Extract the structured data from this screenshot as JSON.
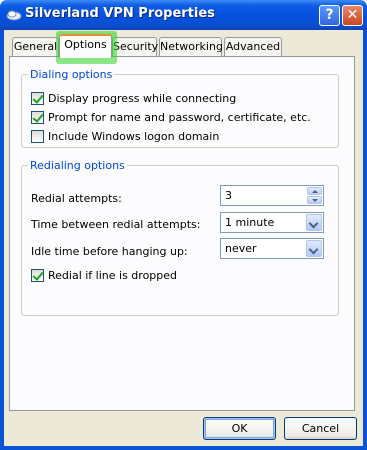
{
  "window": {
    "title": "Silverland VPN Properties",
    "icon": "network-connection-icon",
    "help_button": "?",
    "close_button": "✕"
  },
  "tabs": [
    {
      "label": "General",
      "active": false
    },
    {
      "label": "Options",
      "active": true
    },
    {
      "label": "Security",
      "active": false
    },
    {
      "label": "Networking",
      "active": false
    },
    {
      "label": "Advanced",
      "active": false
    }
  ],
  "dialing": {
    "legend": "Dialing options",
    "options": [
      {
        "label": "Display progress while connecting",
        "checked": true
      },
      {
        "label": "Prompt for name and password, certificate, etc.",
        "checked": true
      },
      {
        "label": "Include Windows logon domain",
        "checked": false
      }
    ]
  },
  "redialing": {
    "legend": "Redialing options",
    "attempts_label": "Redial attempts:",
    "attempts_value": "3",
    "time_label": "Time between redial attempts:",
    "time_value": "1 minute",
    "idle_label": "Idle time before hanging up:",
    "idle_value": "never",
    "redial_dropped_label": "Redial if line is dropped",
    "redial_dropped_checked": true
  },
  "buttons": {
    "ok": "OK",
    "cancel": "Cancel"
  },
  "colors": {
    "title_bar": "#0551e0",
    "group_legend": "#0046d5",
    "active_tab_highlight": "#2bd21f",
    "dialog_background": "#ece9d8"
  }
}
